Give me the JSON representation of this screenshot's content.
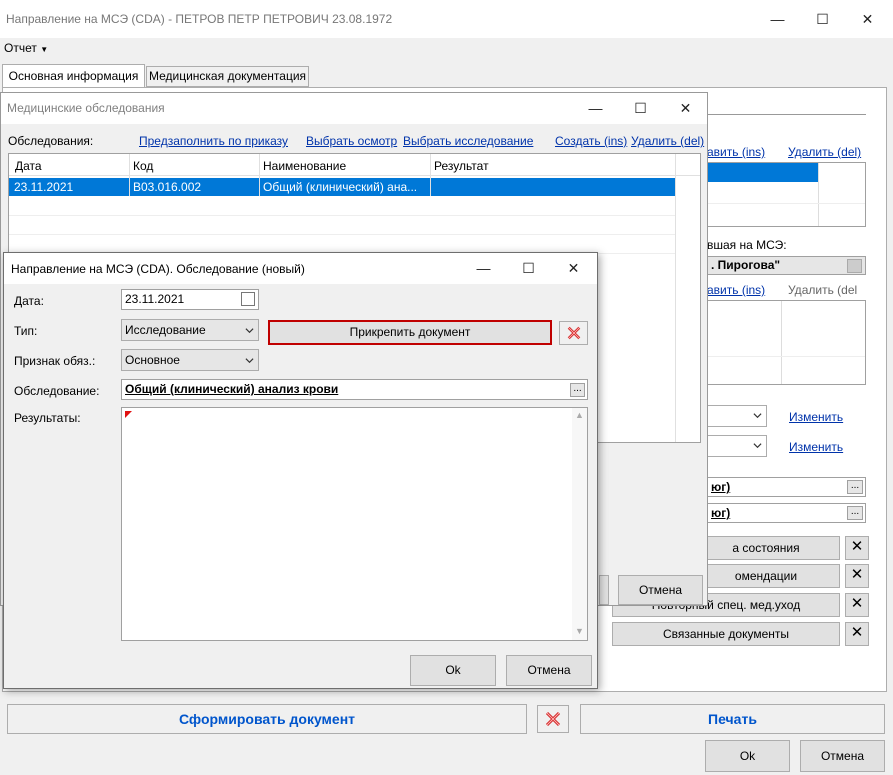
{
  "main": {
    "title": "Направление на МСЭ (CDA) - ПЕТРОВ ПЕТР ПЕТРОВИЧ 23.08.1972",
    "menu": "Отчет",
    "tabs": [
      "Основная информация",
      "Медицинская документация"
    ],
    "right": {
      "link_add1": "авить (ins)",
      "link_del1": "Удалить (del)",
      "label_msz": "вшая на МСЭ:",
      "org": ". Пирогова\"",
      "link_add2": "авить (ins)",
      "link_del2": "Удалить (del",
      "change1": "Изменить",
      "change2": "Изменить",
      "field1": "юг)",
      "field2": "юг)",
      "btn1": "а состояния",
      "btn2": "омендации",
      "btn3": "Повторный спец. мед.уход",
      "btn4": "Связанные документы"
    },
    "form_doc": "Сформировать документ",
    "print": "Печать",
    "ok": "Ok",
    "cancel": "Отмена"
  },
  "exams": {
    "title": "Медицинские обследования",
    "label": "Обследования:",
    "links": [
      "Предзаполнить по приказу",
      "Выбрать осмотр",
      "Выбрать исследование",
      "Создать (ins)",
      "Удалить (del)"
    ],
    "columns": [
      "Дата",
      "Код",
      "Наименование",
      "Результат"
    ],
    "rows": [
      [
        "23.11.2021",
        "B03.016.002",
        "Общий (клинический) ана...",
        ""
      ]
    ],
    "cancel": "Отмена"
  },
  "dialog": {
    "title": "Направление на МСЭ (CDA). Обследование (новый)",
    "date_label": "Дата:",
    "date": "23.11.2021",
    "type_label": "Тип:",
    "type": "Исследование",
    "attach": "Прикрепить документ",
    "sign_label": "Признак обяз.:",
    "sign": "Основное",
    "exam_label": "Обследование:",
    "exam": "Общий (клинический) анализ крови",
    "results_label": "Результаты:",
    "ok": "Ok",
    "cancel": "Отмена"
  },
  "colors": {
    "selection": "#0078d7",
    "link": "#0033aa",
    "highlight": "#c00000",
    "accent": "#0055cc"
  }
}
